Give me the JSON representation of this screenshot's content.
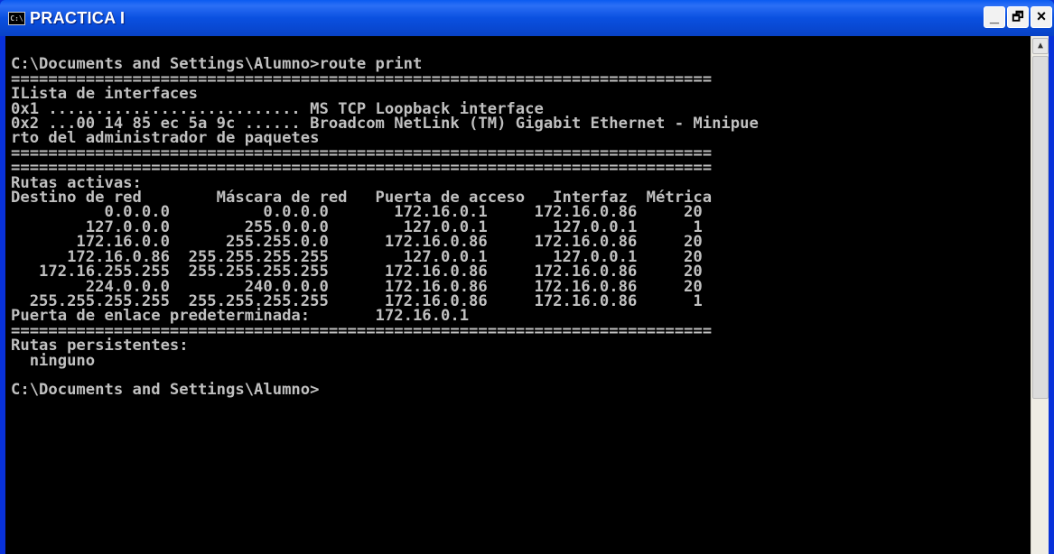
{
  "window": {
    "title": "PRACTICA I",
    "icon": "console-icon",
    "buttons": {
      "minimize": "_",
      "maximize": "🗗",
      "close": "×"
    }
  },
  "console": {
    "lines": [
      "",
      "C:\\Documents and Settings\\Alumno>route print",
      "===========================================================================",
      "ILista de interfaces",
      "0x1 ........................... MS TCP Loopback interface",
      "0x2 ...00 14 85 ec 5a 9c ...... Broadcom NetLink (TM) Gigabit Ethernet - Minipue",
      "rto del administrador de paquetes",
      "===========================================================================",
      "===========================================================================",
      "Rutas activas:",
      "Destino de red        Máscara de red   Puerta de acceso   Interfaz  Métrica",
      "          0.0.0.0          0.0.0.0       172.16.0.1     172.16.0.86     20",
      "        127.0.0.0        255.0.0.0        127.0.0.1       127.0.0.1      1",
      "       172.16.0.0      255.255.0.0      172.16.0.86     172.16.0.86     20",
      "      172.16.0.86  255.255.255.255        127.0.0.1       127.0.0.1     20",
      "   172.16.255.255  255.255.255.255      172.16.0.86     172.16.0.86     20",
      "        224.0.0.0        240.0.0.0      172.16.0.86     172.16.0.86     20",
      "  255.255.255.255  255.255.255.255      172.16.0.86     172.16.0.86      1",
      "Puerta de enlace predeterminada:       172.16.0.1",
      "===========================================================================",
      "Rutas persistentes:",
      "  ninguno",
      "",
      "C:\\Documents and Settings\\Alumno>"
    ]
  },
  "colors": {
    "console_bg": "#000000",
    "console_text": "#c0c0c0",
    "titlebar": "#0a50e0"
  }
}
